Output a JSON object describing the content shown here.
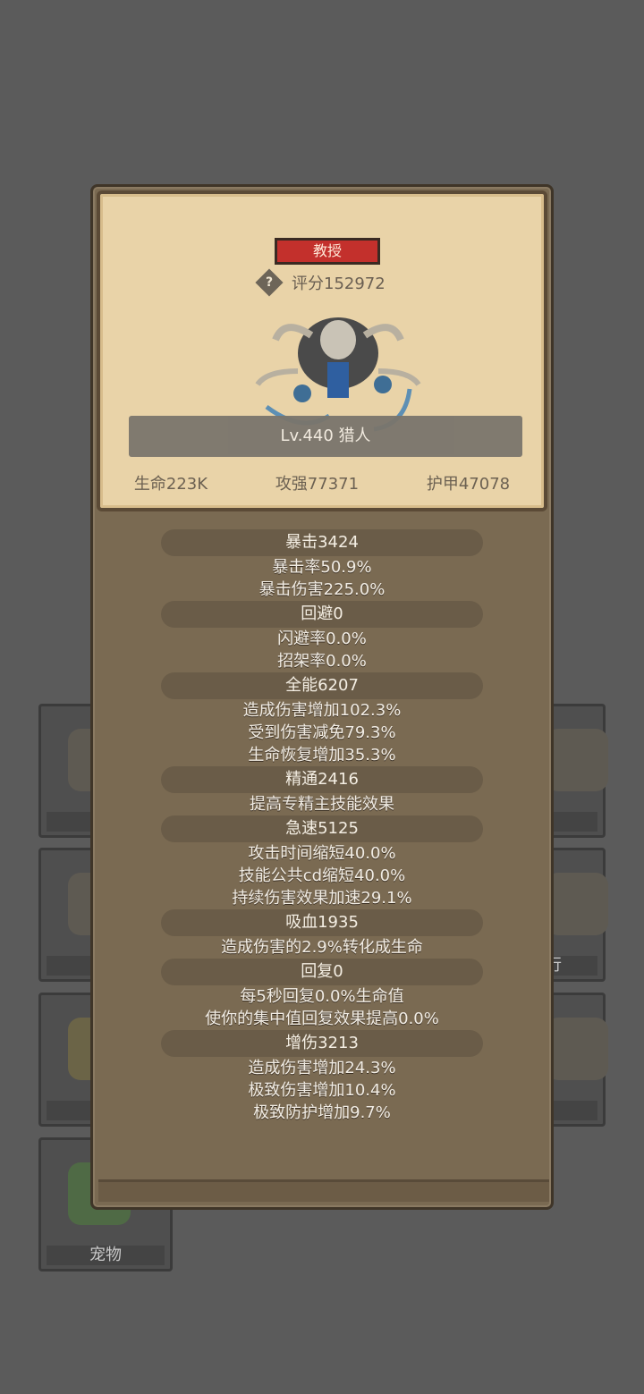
{
  "background_tiles": {
    "pet_label": "宠物",
    "partial_label": "行"
  },
  "card": {
    "class_badge": "教授",
    "score": "评分152972",
    "level_name": "Lv.440 猎人",
    "stats": {
      "life": "生命223K",
      "attack": "攻强77371",
      "armor": "护甲47078"
    }
  },
  "attributes": [
    {
      "head": "暴击3424",
      "lines": [
        "暴击率50.9%",
        "暴击伤害225.0%"
      ]
    },
    {
      "head": "回避0",
      "lines": [
        "闪避率0.0%",
        "招架率0.0%"
      ]
    },
    {
      "head": "全能6207",
      "lines": [
        "造成伤害增加102.3%",
        "受到伤害减免79.3%",
        "生命恢复增加35.3%"
      ]
    },
    {
      "head": "精通2416",
      "lines": [
        "提高专精主技能效果"
      ]
    },
    {
      "head": "急速5125",
      "lines": [
        "攻击时间缩短40.0%",
        "技能公共cd缩短40.0%",
        "持续伤害效果加速29.1%"
      ]
    },
    {
      "head": "吸血1935",
      "lines": [
        "造成伤害的2.9%转化成生命"
      ]
    },
    {
      "head": "回复0",
      "lines": [
        "每5秒回复0.0%生命值",
        "使你的集中值回复效果提高0.0%"
      ]
    },
    {
      "head": "增伤3213",
      "lines": [
        "造成伤害增加24.3%",
        "极致伤害增加10.4%",
        "极致防护增加9.7%"
      ]
    }
  ]
}
